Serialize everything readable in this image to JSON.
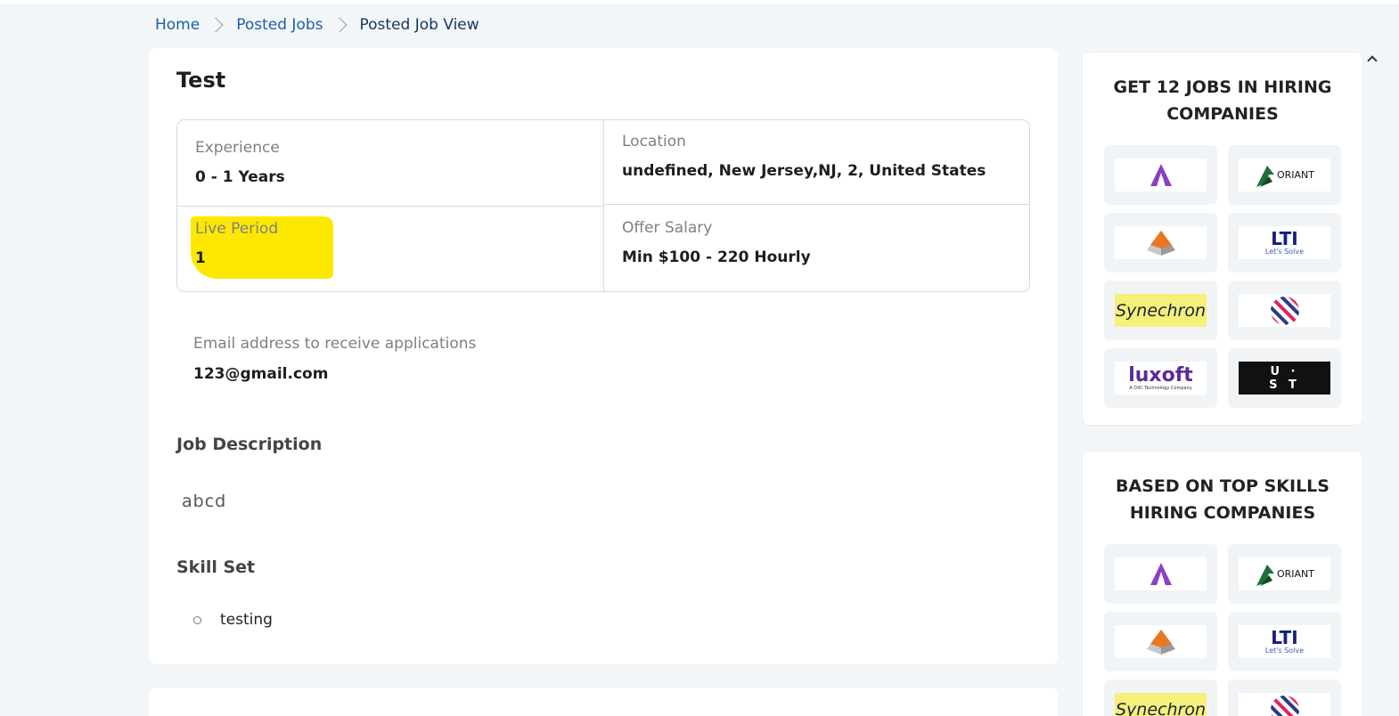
{
  "breadcrumb": {
    "home": "Home",
    "posted_jobs": "Posted Jobs",
    "current": "Posted Job View"
  },
  "job": {
    "title": "Test",
    "experience": {
      "label": "Experience",
      "value": "0 - 1 Years"
    },
    "location": {
      "label": "Location",
      "value": "undefined, New Jersey,NJ, 2, United States"
    },
    "live_period": {
      "label": "Live Period",
      "value": "1"
    },
    "salary": {
      "label": "Offer Salary",
      "value": "Min $100 - 220 Hourly"
    },
    "email": {
      "label": "Email address to receive applications",
      "value": "123@gmail.com"
    },
    "description_title": "Job Description",
    "description": "abcd",
    "skills_title": "Skill Set",
    "skills": [
      "testing"
    ]
  },
  "sidebar": {
    "card1": {
      "title_line1": "GET 12 JOBS IN HIRING",
      "title_line2": "COMPANIES"
    },
    "card2": {
      "title_line1": "BASED ON TOP SKILLS",
      "title_line2": "HIRING COMPANIES"
    },
    "logos": {
      "oriant": "ORIANT",
      "lti": "LTI",
      "lti_tagline": "Let's Solve",
      "synechron": "Synechron",
      "luxoft": "luxoft",
      "luxoft_tagline": "A DXC Technology Company",
      "ust_top": "U ·",
      "ust_bottom": "S T"
    }
  },
  "colors": {
    "accent_link": "#1d5fa8",
    "highlight": "#ffe800",
    "background": "#f3f6f8"
  }
}
